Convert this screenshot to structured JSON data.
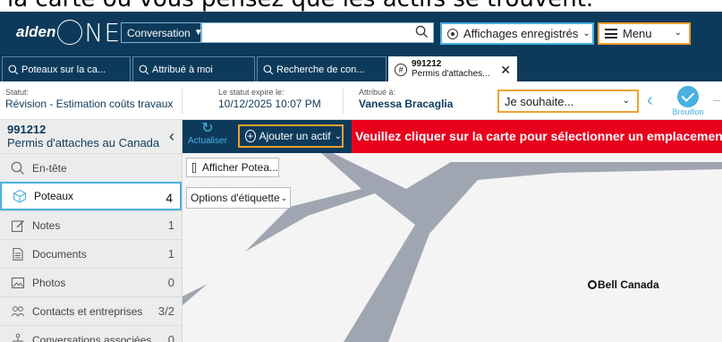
{
  "caption": "la carte où vous pensez que les actifs se trouvent.",
  "header": {
    "logo_text": "alden",
    "logo_one": "NE",
    "conversation_select": "Conversation",
    "search_value": "",
    "views_label": "Affichages enregistrés",
    "menu_label": "Menu"
  },
  "tabs": [
    {
      "label": "Poteaux sur la ca..."
    },
    {
      "label": "Attribué à moi"
    },
    {
      "label": "Recherche de con..."
    },
    {
      "number": "991212",
      "label": "Permis d'attaches..."
    }
  ],
  "status": {
    "statut_label": "Statut:",
    "statut_value": "Révision - Estimation coûts travaux",
    "expire_label": "Le statut expire le:",
    "expire_value": "10/12/2025 10:07 PM",
    "assigned_label": "Attribué à:",
    "assigned_value": "Vanessa Bracaglia",
    "wish_label": "Je souhaite...",
    "draft_label": "Brouillon"
  },
  "sidebar": {
    "number": "991212",
    "title": "Permis d'attaches au Canada",
    "items": [
      {
        "label": "En-tête",
        "count": "",
        "icon": "search-icon"
      },
      {
        "label": "Poteaux",
        "count": "4",
        "icon": "cube-icon"
      },
      {
        "label": "Notes",
        "count": "1",
        "icon": "note-edit-icon"
      },
      {
        "label": "Documents",
        "count": "1",
        "icon": "document-icon"
      },
      {
        "label": "Photos",
        "count": "0",
        "icon": "photo-icon"
      },
      {
        "label": "Contacts et entreprises",
        "count": "3/2",
        "icon": "contacts-icon"
      },
      {
        "label": "Conversations associées",
        "count": "0",
        "icon": "network-icon"
      }
    ]
  },
  "toolbar": {
    "refresh_label": "Actualiser",
    "add_asset_label": "Ajouter un actif",
    "banner": "Veuillez cliquer sur la carte pour sélectionner un emplacement pour cet"
  },
  "map": {
    "show_poles_label": "Afficher Potea...",
    "label_options": "Options d'étiquette",
    "marker_label": "Bell Canada"
  },
  "colors": {
    "navy": "#0d3a5b",
    "accent_blue": "#4ab0e0",
    "accent_orange": "#f0a030",
    "alert_red": "#e8001c"
  }
}
